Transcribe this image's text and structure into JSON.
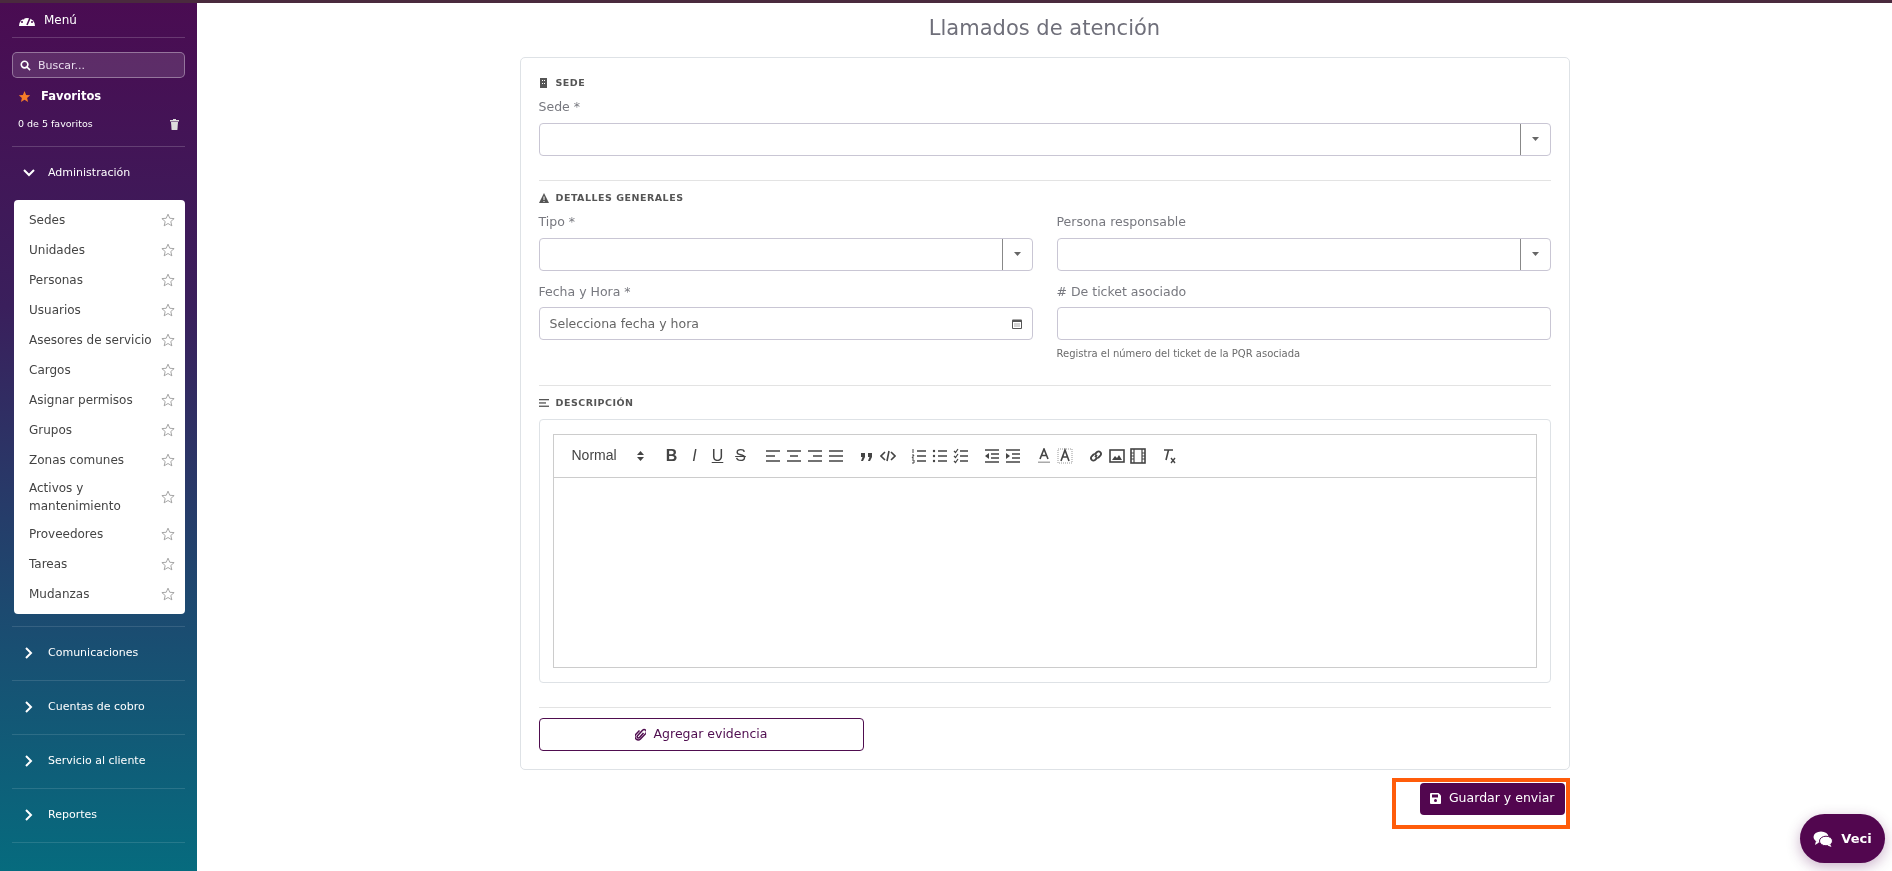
{
  "sidebar": {
    "title": "Menú",
    "search": {
      "placeholder": "Buscar..."
    },
    "favorites": {
      "title": "Favoritos",
      "count": "0 de 5 favoritos"
    },
    "groups": [
      {
        "label": "Administración",
        "expanded": true,
        "items": [
          {
            "label": "Sedes",
            "favorite": false
          },
          {
            "label": "Unidades",
            "favorite": false
          },
          {
            "label": "Personas",
            "favorite": false
          },
          {
            "label": "Usuarios",
            "favorite": false
          },
          {
            "label": "Asesores de servicio",
            "favorite": false
          },
          {
            "label": "Cargos",
            "favorite": false
          },
          {
            "label": "Asignar permisos",
            "favorite": false
          },
          {
            "label": "Grupos",
            "favorite": false
          },
          {
            "label": "Zonas comunes",
            "favorite": false
          },
          {
            "label": "Activos y mantenimiento",
            "favorite": false
          },
          {
            "label": "Proveedores",
            "favorite": false
          },
          {
            "label": "Tareas",
            "favorite": false
          },
          {
            "label": "Mudanzas",
            "favorite": false
          }
        ]
      },
      {
        "label": "Comunicaciones",
        "expanded": false
      },
      {
        "label": "Cuentas de cobro",
        "expanded": false
      },
      {
        "label": "Servicio al cliente",
        "expanded": false
      },
      {
        "label": "Reportes",
        "expanded": false
      }
    ]
  },
  "page_title": "Llamados de atención",
  "sections": [
    {
      "heading": "SEDE",
      "fields": [
        {
          "kind": "select",
          "label": "Sede *"
        }
      ]
    },
    {
      "heading": "DETALLES GENERALES",
      "fields": [
        {
          "kind": "select",
          "label": "Tipo *"
        },
        {
          "kind": "select",
          "label": "Persona responsable"
        },
        {
          "kind": "date",
          "label": "Fecha y Hora *",
          "placeholder": "Selecciona fecha y hora"
        },
        {
          "kind": "text",
          "label": "# De ticket asociado",
          "help": "Registra el número del ticket de la PQR asociada"
        }
      ]
    },
    {
      "heading": "DESCRIPCIÓN",
      "fields": [
        {
          "kind": "editor",
          "toolbar": [
            [
              {
                "kind": "header",
                "text": "Normal"
              }
            ],
            [
              {
                "kind": "letter",
                "text": "B"
              },
              {
                "kind": "letter",
                "text": "I"
              },
              {
                "kind": "letter",
                "text": "U"
              },
              {
                "kind": "letter",
                "text": "S"
              }
            ],
            [
              {
                "kind": "align-left"
              },
              {
                "kind": "align-center"
              },
              {
                "kind": "align-right"
              },
              {
                "kind": "justify"
              }
            ],
            [
              {
                "kind": "quote"
              },
              {
                "kind": "code"
              }
            ],
            [
              {
                "kind": "ordered-list"
              },
              {
                "kind": "bullet-list"
              },
              {
                "kind": "check-list"
              }
            ],
            [
              {
                "kind": "outdent"
              },
              {
                "kind": "indent"
              }
            ],
            [
              {
                "kind": "text-color"
              },
              {
                "kind": "background"
              }
            ],
            [
              {
                "kind": "link"
              },
              {
                "kind": "image"
              },
              {
                "kind": "video"
              }
            ],
            [
              {
                "kind": "clear"
              }
            ]
          ]
        }
      ]
    }
  ],
  "evidence_button": "Agregar evidencia",
  "submit_button": {
    "label": "Guardar y enviar",
    "highlighted": true
  },
  "chat_button": "Veci"
}
